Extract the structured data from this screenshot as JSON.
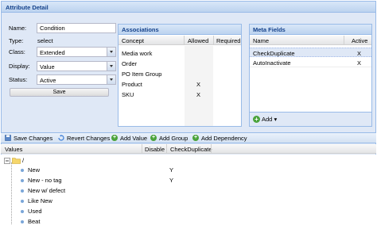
{
  "window": {
    "title": "Attribute Detail"
  },
  "form": {
    "name_label": "Name:",
    "name_value": "Condition",
    "type_label": "Type:",
    "type_value": "select",
    "class_label": "Class:",
    "class_value": "Extended",
    "display_label": "Display:",
    "display_value": "Value",
    "status_label": "Status:",
    "status_value": "Active",
    "save_label": "Save"
  },
  "associations": {
    "title": "Associations",
    "columns": {
      "concept": "Concept",
      "allowed": "Allowed",
      "required": "Required"
    },
    "rows": [
      {
        "concept": "Media work",
        "allowed": "",
        "required": ""
      },
      {
        "concept": "Order",
        "allowed": "",
        "required": ""
      },
      {
        "concept": "PO Item Group",
        "allowed": "",
        "required": ""
      },
      {
        "concept": "Product",
        "allowed": "X",
        "required": ""
      },
      {
        "concept": "SKU",
        "allowed": "X",
        "required": ""
      }
    ]
  },
  "meta_fields": {
    "title": "Meta Fields",
    "columns": {
      "name": "Name",
      "active": "Active"
    },
    "rows": [
      {
        "name": "CheckDuplicate",
        "active": "X"
      },
      {
        "name": "AutoInactivate",
        "active": "X"
      }
    ],
    "add_label": "Add"
  },
  "toolbar": {
    "save_changes": "Save Changes",
    "revert_changes": "Revert Changes",
    "add_value": "Add Value",
    "add_group": "Add Group",
    "add_dependency": "Add Dependency"
  },
  "values_tree": {
    "columns": {
      "values": "Values",
      "disable": "Disable",
      "check_duplicate": "CheckDuplicate"
    },
    "root": "/",
    "items": [
      {
        "label": "New",
        "disable": "",
        "check_duplicate": "Y"
      },
      {
        "label": "New - no tag",
        "disable": "",
        "check_duplicate": "Y"
      },
      {
        "label": "New w/ defect",
        "disable": "",
        "check_duplicate": ""
      },
      {
        "label": "Like New",
        "disable": "",
        "check_duplicate": ""
      },
      {
        "label": "Used",
        "disable": "",
        "check_duplicate": ""
      },
      {
        "label": "Beat",
        "disable": "",
        "check_duplicate": ""
      }
    ]
  },
  "colors": {
    "header_text": "#15428b",
    "border": "#99bbe8",
    "panel_bg": "#dfe8f6",
    "add_icon": "#4aa33a"
  }
}
